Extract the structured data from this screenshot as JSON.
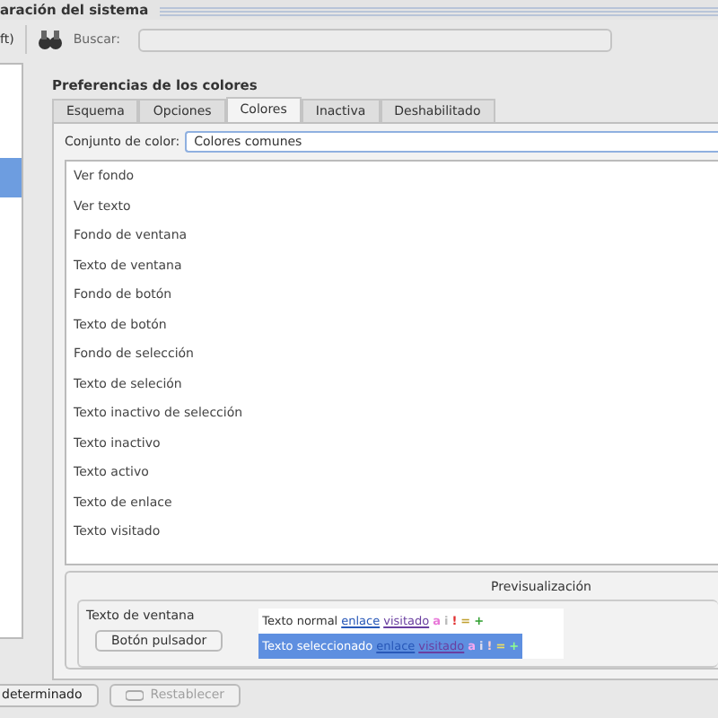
{
  "window": {
    "title": "aración del sistema"
  },
  "toolbar": {
    "left_text": "ft)",
    "search_label": "Buscar:"
  },
  "sidebar": {
    "items": [
      {
        "selected": true
      }
    ]
  },
  "heading": "Preferencias de los colores",
  "tabs": [
    {
      "label": "Esquema",
      "selected": false
    },
    {
      "label": "Opciones",
      "selected": false
    },
    {
      "label": "Colores",
      "selected": true
    },
    {
      "label": "Inactiva",
      "selected": false
    },
    {
      "label": "Deshabilitado",
      "selected": false
    }
  ],
  "color_set": {
    "label": "Conjunto de color:",
    "value": "Colores comunes"
  },
  "color_roles": [
    "Ver fondo",
    "Ver texto",
    "Fondo de ventana",
    "Texto de ventana",
    "Fondo de botón",
    "Texto de botón",
    "Fondo de selección",
    "Texto de seleción",
    "Texto inactivo de selección",
    "Texto inactivo",
    "Texto activo",
    "Texto de enlace",
    "Texto visitado"
  ],
  "preview": {
    "title": "Previsualización",
    "window_text": "Texto de ventana",
    "push_button": "Botón pulsador",
    "lines": [
      {
        "kind": "normal",
        "text": "Texto normal",
        "link": "enlace",
        "visited": "visitado",
        "marks": [
          "a",
          "i",
          "!",
          "=",
          "+"
        ]
      },
      {
        "kind": "selected",
        "text": "Texto seleccionado",
        "link": "enlace",
        "visited": "visitado",
        "marks": [
          "a",
          "i",
          "!",
          "=",
          "+"
        ]
      }
    ]
  },
  "buttons": [
    {
      "label": "determinado",
      "disabled": false
    },
    {
      "label": "Restablecer",
      "disabled": true
    }
  ]
}
